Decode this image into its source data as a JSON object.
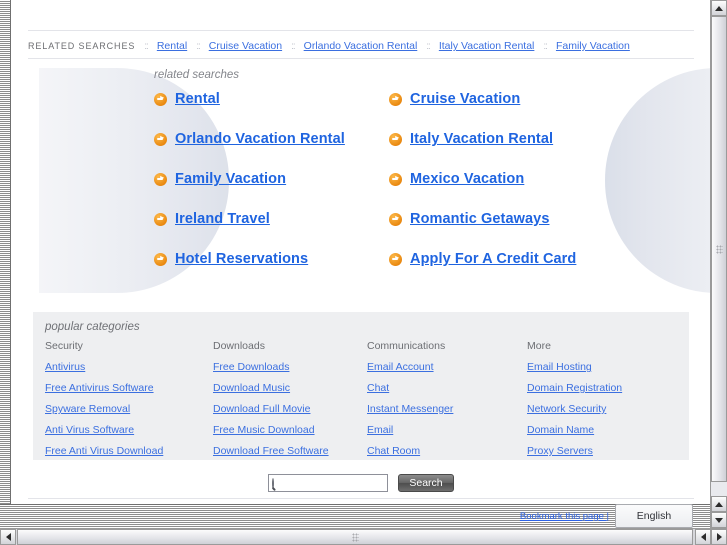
{
  "window": {
    "scrollbars": {
      "vertical_up": "▲",
      "vertical_down": "▼",
      "horizontal_left": "◀",
      "horizontal_right": "▶"
    }
  },
  "topnav": {
    "label": "RELATED SEARCHES",
    "separator": "::",
    "links": [
      "Rental",
      "Cruise Vacation",
      "Orlando Vacation Rental",
      "Italy Vacation Rental",
      "Family Vacation"
    ]
  },
  "related_searches": {
    "title": "related searches",
    "icon": "arrow-circle-icon",
    "items": [
      "Rental",
      "Cruise Vacation",
      "Orlando Vacation Rental",
      "Italy Vacation Rental",
      "Family Vacation",
      "Mexico Vacation",
      "Ireland Travel",
      "Romantic Getaways",
      "Hotel Reservations",
      "Apply For A Credit Card"
    ]
  },
  "popular_categories": {
    "title": "popular categories",
    "columns": [
      {
        "heading": "Security",
        "links": [
          "Antivirus",
          "Free Antivirus Software",
          "Spyware Removal",
          "Anti Virus Software",
          "Free Anti Virus Download"
        ]
      },
      {
        "heading": "Downloads",
        "links": [
          "Free Downloads",
          "Download Music",
          "Download Full Movie",
          "Free Music Download",
          "Download Free Software"
        ]
      },
      {
        "heading": "Communications",
        "links": [
          "Email Account",
          "Chat",
          "Instant Messenger",
          "Email",
          "Chat Room"
        ]
      },
      {
        "heading": "More",
        "links": [
          "Email Hosting",
          "Domain Registration",
          "Network Security",
          "Domain Name",
          "Proxy Servers"
        ]
      }
    ]
  },
  "search": {
    "icon": "magnifier-icon",
    "value": "",
    "placeholder": "",
    "button_label": "Search"
  },
  "footer": {
    "bookmark_label": "Bookmark this page |",
    "language": "English"
  },
  "colors": {
    "link_blue": "#3b6fe0",
    "link_blue_bold": "#1f64e0",
    "arrow_orange": "#e8860d",
    "panel_gray": "#eeeff1",
    "muted_text": "#6d6e72"
  }
}
